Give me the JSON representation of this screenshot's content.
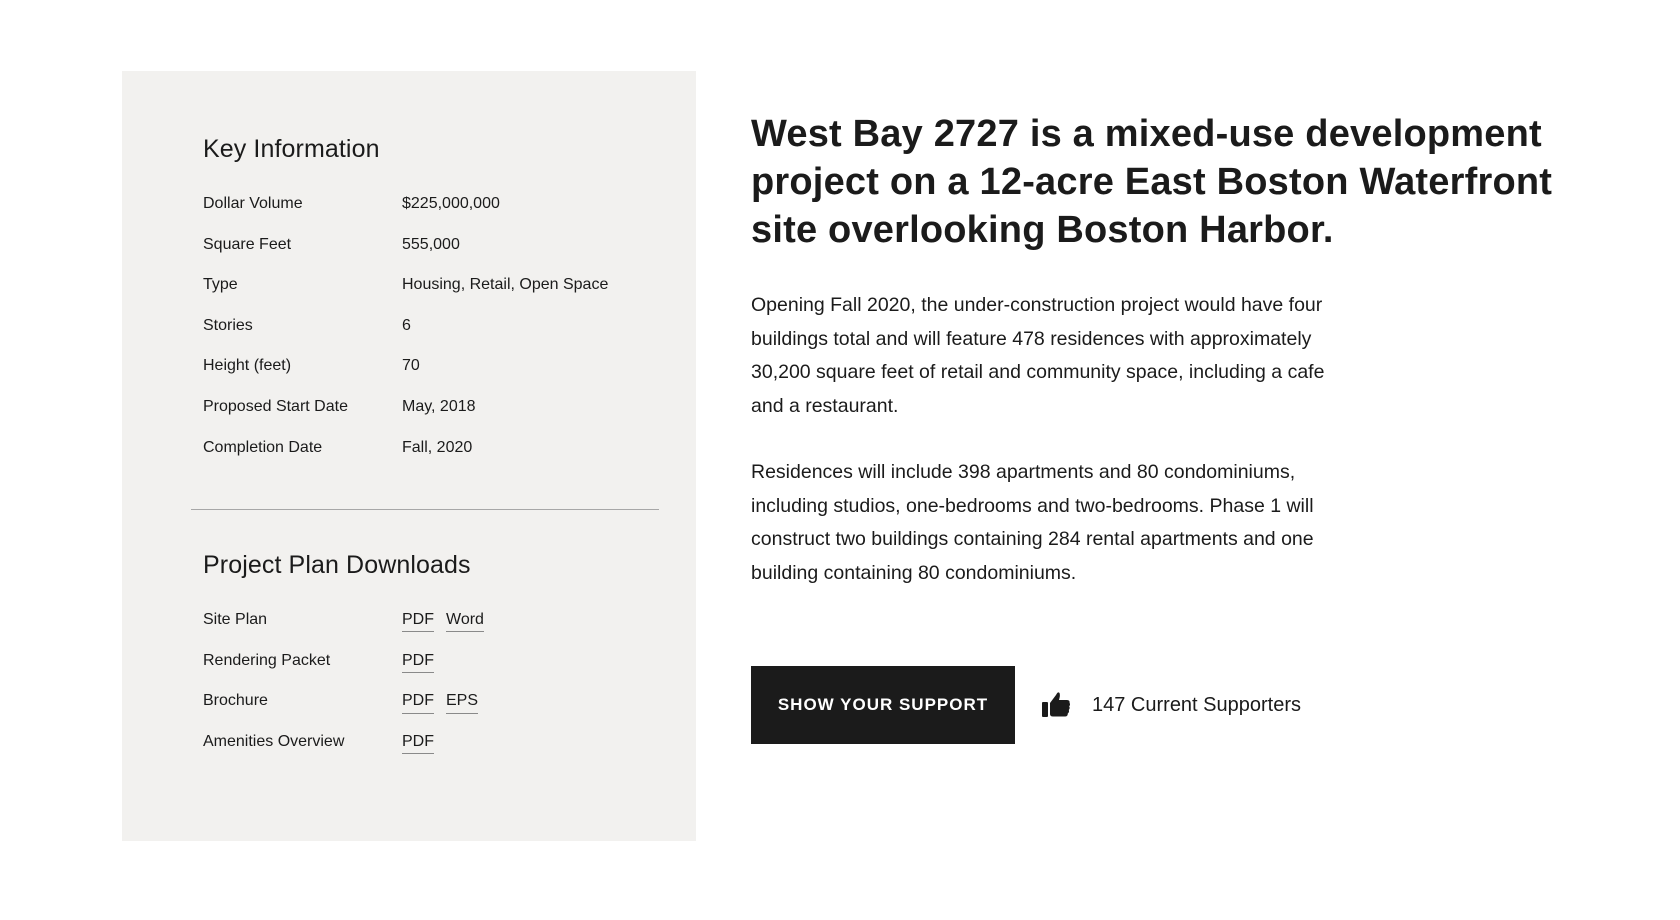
{
  "key_information": {
    "title": "Key Information",
    "rows": [
      {
        "label": "Dollar Volume",
        "value": "$225,000,000"
      },
      {
        "label": "Square Feet",
        "value": "555,000"
      },
      {
        "label": "Type",
        "value": "Housing, Retail, Open Space"
      },
      {
        "label": "Stories",
        "value": "6"
      },
      {
        "label": "Height (feet)",
        "value": "70"
      },
      {
        "label": "Proposed Start Date",
        "value": "May, 2018"
      },
      {
        "label": "Completion Date",
        "value": "Fall, 2020"
      }
    ]
  },
  "downloads": {
    "title": "Project Plan Downloads",
    "rows": [
      {
        "label": "Site Plan",
        "links": [
          "PDF",
          "Word"
        ]
      },
      {
        "label": "Rendering Packet",
        "links": [
          "PDF"
        ]
      },
      {
        "label": "Brochure",
        "links": [
          "PDF",
          "EPS"
        ]
      },
      {
        "label": "Amenities Overview",
        "links": [
          "PDF"
        ]
      }
    ]
  },
  "main": {
    "headline": "West Bay 2727 is a mixed-use development project on a 12-acre East Boston Waterfront site overlooking Boston Harbor.",
    "paragraphs": [
      "Opening Fall 2020, the under-construction project would have four buildings total and will feature 478 residences with approximately 30,200 square feet of retail and community space, including a cafe and a restaurant.",
      "Residences will include 398 apartments and 80 condominiums, including studios, one-bedrooms and two-bedrooms. Phase 1 will construct two buildings containing 284 rental apartments and one building containing 80 condominiums."
    ]
  },
  "support": {
    "button_label": "SHOW YOUR SUPPORT",
    "supporters_text": "147 Current Supporters",
    "icon": "thumbs-up-icon"
  },
  "colors": {
    "panel_background": "#f2f1ef",
    "text": "#1b1b1b",
    "button_background": "#1b1b1b",
    "button_text": "#ffffff",
    "divider": "#a7a7a7"
  }
}
